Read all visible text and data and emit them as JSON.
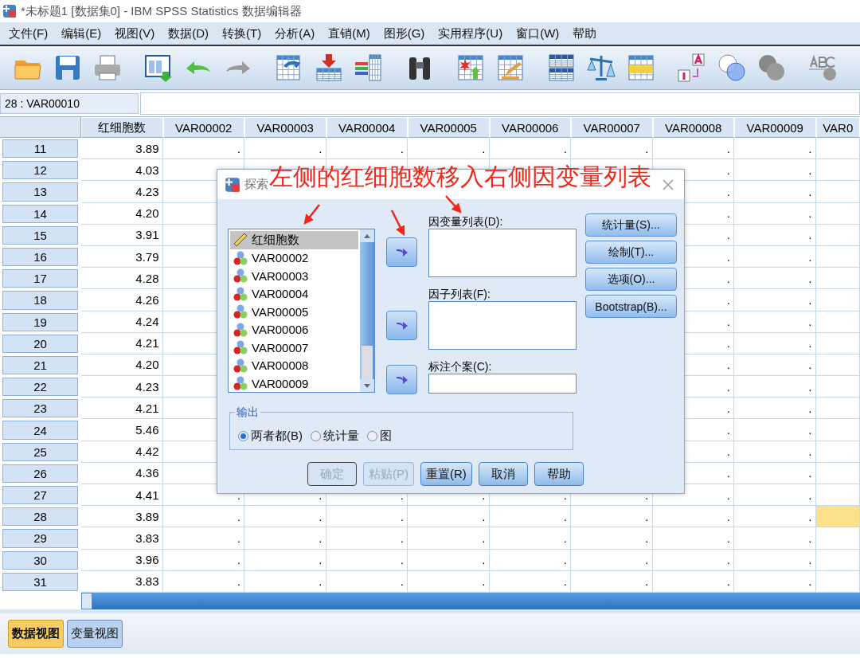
{
  "window": {
    "title": "*未标题1 [数据集0] - IBM SPSS Statistics 数据编辑器"
  },
  "menu": [
    "文件(F)",
    "编辑(E)",
    "视图(V)",
    "数据(D)",
    "转换(T)",
    "分析(A)",
    "直销(M)",
    "图形(G)",
    "实用程序(U)",
    "窗口(W)",
    "帮助"
  ],
  "cell_reference": "28 : VAR00010",
  "grid": {
    "columns": [
      "红细胞数",
      "VAR00002",
      "VAR00003",
      "VAR00004",
      "VAR00005",
      "VAR00006",
      "VAR00007",
      "VAR00008",
      "VAR00009",
      "VAR0"
    ],
    "rows": [
      {
        "number": "11",
        "value": "3.89",
        "cells": [
          ".",
          ".",
          ".",
          ".",
          ".",
          ".",
          ".",
          "."
        ],
        "selected": false
      },
      {
        "number": "12",
        "value": "4.03",
        "cells": [
          ".",
          "."
        ],
        "selected": false
      },
      {
        "number": "13",
        "value": "4.23",
        "cells": [
          ".",
          "."
        ],
        "selected": false
      },
      {
        "number": "14",
        "value": "4.20",
        "cells": [
          ".",
          "."
        ],
        "selected": false
      },
      {
        "number": "15",
        "value": "3.91",
        "cells": [
          ".",
          "."
        ],
        "selected": false
      },
      {
        "number": "16",
        "value": "3.79",
        "cells": [
          ".",
          "."
        ],
        "selected": false
      },
      {
        "number": "17",
        "value": "4.28",
        "cells": [
          ".",
          "."
        ],
        "selected": false
      },
      {
        "number": "18",
        "value": "4.26",
        "cells": [
          ".",
          "."
        ],
        "selected": false
      },
      {
        "number": "19",
        "value": "4.24",
        "cells": [
          ".",
          "."
        ],
        "selected": false
      },
      {
        "number": "20",
        "value": "4.21",
        "cells": [
          ".",
          "."
        ],
        "selected": false
      },
      {
        "number": "21",
        "value": "4.20",
        "cells": [
          ".",
          "."
        ],
        "selected": false
      },
      {
        "number": "22",
        "value": "4.23",
        "cells": [
          ".",
          "."
        ],
        "selected": false
      },
      {
        "number": "23",
        "value": "4.21",
        "cells": [
          ".",
          "."
        ],
        "selected": false
      },
      {
        "number": "24",
        "value": "5.46",
        "cells": [
          ".",
          "."
        ],
        "selected": false
      },
      {
        "number": "25",
        "value": "4.42",
        "cells": [
          ".",
          "."
        ],
        "selected": false
      },
      {
        "number": "26",
        "value": "4.36",
        "cells": [
          ".",
          "."
        ],
        "selected": false
      },
      {
        "number": "27",
        "value": "4.41",
        "cells": [
          ".",
          ".",
          ".",
          ".",
          ".",
          ".",
          ".",
          "."
        ],
        "selected": false
      },
      {
        "number": "28",
        "value": "3.89",
        "cells": [
          ".",
          ".",
          ".",
          ".",
          ".",
          ".",
          ".",
          "."
        ],
        "selected": true
      },
      {
        "number": "29",
        "value": "3.83",
        "cells": [
          ".",
          ".",
          ".",
          ".",
          ".",
          ".",
          ".",
          "."
        ],
        "selected": false
      },
      {
        "number": "30",
        "value": "3.96",
        "cells": [
          ".",
          ".",
          ".",
          ".",
          ".",
          ".",
          ".",
          "."
        ],
        "selected": false
      },
      {
        "number": "31",
        "value": "3.83",
        "cells": [
          ".",
          ".",
          ".",
          ".",
          ".",
          ".",
          ".",
          "."
        ],
        "selected": false
      }
    ]
  },
  "dialog": {
    "title": "探索",
    "variables": [
      {
        "name": "红细胞数",
        "kind": "scale",
        "selected": true
      },
      {
        "name": "VAR00002",
        "kind": "nominal",
        "selected": false
      },
      {
        "name": "VAR00003",
        "kind": "nominal",
        "selected": false
      },
      {
        "name": "VAR00004",
        "kind": "nominal",
        "selected": false
      },
      {
        "name": "VAR00005",
        "kind": "nominal",
        "selected": false
      },
      {
        "name": "VAR00006",
        "kind": "nominal",
        "selected": false
      },
      {
        "name": "VAR00007",
        "kind": "nominal",
        "selected": false
      },
      {
        "name": "VAR00008",
        "kind": "nominal",
        "selected": false
      },
      {
        "name": "VAR00009",
        "kind": "nominal",
        "selected": false
      }
    ],
    "fields": [
      {
        "label": "因变量列表(D):",
        "kind": "list"
      },
      {
        "label": "因子列表(F):",
        "kind": "list"
      },
      {
        "label": "标注个案(C):",
        "kind": "single"
      }
    ],
    "side_buttons": [
      "统计量(S)...",
      "绘制(T)...",
      "选项(O)...",
      "Bootstrap(B)..."
    ],
    "output": {
      "legend": "输出",
      "options": [
        {
          "label": "两者都(B)",
          "selected": true
        },
        {
          "label": "统计量",
          "selected": false
        },
        {
          "label": "图",
          "selected": false
        }
      ]
    },
    "buttons": [
      {
        "label": "确定",
        "disabled": true
      },
      {
        "label": "粘贴(P)",
        "disabled": true
      },
      {
        "label": "重置(R)",
        "disabled": false
      },
      {
        "label": "取消",
        "disabled": false
      },
      {
        "label": "帮助",
        "disabled": false
      }
    ]
  },
  "annotation": {
    "text": "左侧的红细胞数移入右侧因变量列表"
  },
  "view_tabs": [
    {
      "label": "数据视图",
      "selected": true
    },
    {
      "label": "变量视图",
      "selected": false
    }
  ]
}
